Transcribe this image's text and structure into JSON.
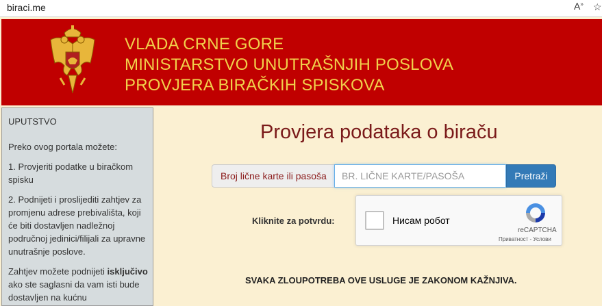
{
  "browser": {
    "url": "biraci.me",
    "icons": [
      "read-aloud-icon",
      "favorite-star-icon"
    ]
  },
  "header": {
    "line1": "VLADA CRNE GORE",
    "line2": "MINISTARSTVO UNUTRAŠNJIH POSLOVA",
    "line3": "PROVJERA BIRAČKIH SPISKOVA",
    "colors": {
      "background": "#c00000",
      "text": "#f1d04b"
    }
  },
  "sidebar": {
    "heading": "UPUTSTVO",
    "intro": "Preko ovog portala možete:",
    "item1": "1. Provjeriti podatke u biračkom spisku",
    "item2": "2. Podnijeti i proslijediti zahtjev za promjenu adrese prebivališta, koji će biti dostavljen nadležnoj područnoj jedinici/filijali za upravne unutrašnje poslove.",
    "note_prefix": "Zahtjev možete podnijeti",
    "note_bold": "isključivo",
    "note_suffix": "ako ste saglasni da vam isti bude dostavljen na kućnu"
  },
  "main": {
    "title": "Provjera podataka o biraču",
    "search": {
      "label": "Broj lične karte ili pasoša",
      "placeholder": "BR. LIČNE KARTE/PASOŠA",
      "value": "",
      "button": "Pretraži"
    },
    "confirm_label": "Kliknite za potvrdu:",
    "recaptcha": {
      "checkbox_label": "Нисам робот",
      "brand": "reCAPTCHA",
      "links": "Приватност - Услови"
    },
    "warning": "SVAKA ZLOUPOTREBA OVE USLUGE JE ZAKONOM KAŽNJIVA."
  },
  "colors": {
    "page_background": "#fbf0d2",
    "title": "#7a1a1a",
    "button": "#337ab7",
    "sidebar_background": "#d6dcde"
  }
}
